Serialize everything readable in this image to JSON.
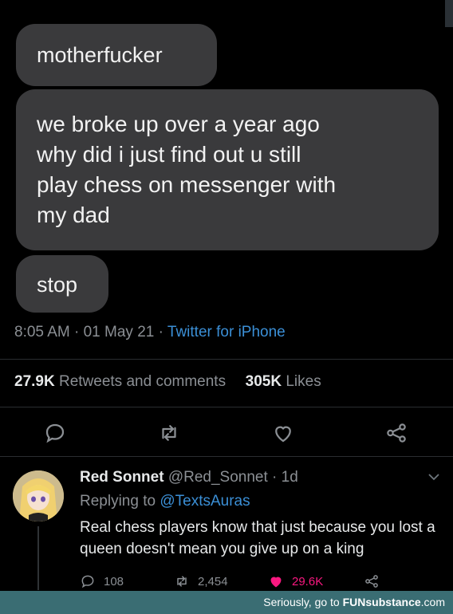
{
  "messages": {
    "first": "motherfucker",
    "second_lines": [
      "we broke up over a year ago",
      "why did i just find out u still",
      "play chess  on messenger with",
      "my dad"
    ],
    "third": "stop"
  },
  "tweet_meta": {
    "time": "8:05 AM",
    "sep1": " · ",
    "date": "01 May 21",
    "sep2": " · ",
    "source": "Twitter for iPhone"
  },
  "stats": {
    "retweets_count": "27.9K",
    "retweets_label": " Retweets and comments",
    "likes_count": "305K",
    "likes_label": " Likes"
  },
  "actions": {
    "reply_icon": "comment-icon",
    "retweet_icon": "retweet-icon",
    "like_icon": "heart-icon",
    "share_icon": "share-icon"
  },
  "reply": {
    "display_name": "Red Sonnet",
    "handle": "@Red_Sonnet",
    "sep": " · ",
    "age": "1d",
    "replying_prefix": "Replying to ",
    "replying_handle": "@TextsAuras",
    "text": "Real chess players know that just because you lost a queen doesn't mean you give up on a king",
    "comments": "108",
    "retweets": "2,454",
    "likes": "29.6K"
  },
  "footer": {
    "prefix": "Seriously, go to ",
    "brand": "FUNsubstance",
    "suffix": ".com"
  },
  "colors": {
    "link": "#3b8fd6",
    "like": "#f91880",
    "bubble": "#3a3a3c",
    "footer": "#3a6d73"
  }
}
